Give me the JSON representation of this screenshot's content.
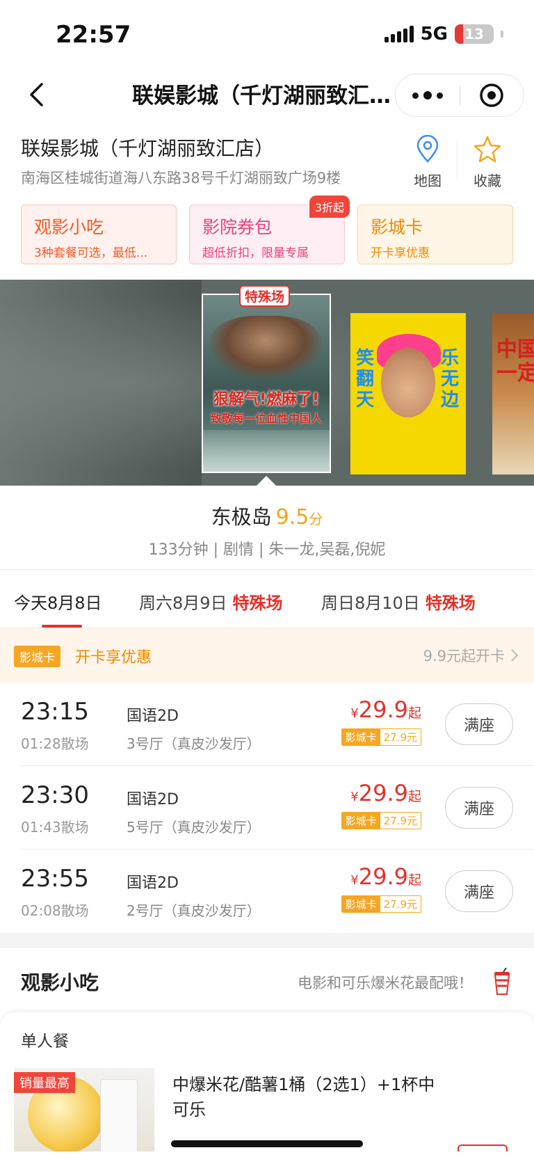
{
  "status_bar": {
    "time": "22:57",
    "network": "5G",
    "battery": "13"
  },
  "nav": {
    "title": "联娱影城（千灯湖丽致汇店）"
  },
  "cinema": {
    "name": "联娱影城（千灯湖丽致汇店）",
    "address": "南海区桂城街道海八东路38号千灯湖丽致广场9楼",
    "map_label": "地图",
    "favorite_label": "收藏"
  },
  "features": [
    {
      "title": "观影小吃",
      "subtitle": "3种套餐可选，最低...",
      "badge": ""
    },
    {
      "title": "影院券包",
      "subtitle": "超低折扣，限量专属",
      "badge": "3折起"
    },
    {
      "title": "影城卡",
      "subtitle": "开卡享优惠",
      "badge": ""
    }
  ],
  "carousel": {
    "special_tag": "特殊场",
    "posters": [
      {
        "line1": "狠解气!燃麻了!",
        "line2": "致敬每一位血性中国人"
      },
      {
        "left_text": "笑翻天",
        "right_text": "乐无边"
      },
      {
        "text": "中国一定"
      }
    ]
  },
  "movie": {
    "title": "东极岛",
    "score": "9.5",
    "score_unit": "分",
    "meta": "133分钟 | 剧情 | 朱一龙,吴磊,倪妮"
  },
  "date_tabs": [
    {
      "label": "今天8月8日",
      "special": ""
    },
    {
      "label": "周六8月9日",
      "special": "特殊场"
    },
    {
      "label": "周日8月10日",
      "special": "特殊场"
    }
  ],
  "promo": {
    "badge": "影城卡",
    "text": "开卡享优惠",
    "right": "9.9元起开卡"
  },
  "showtimes": [
    {
      "start": "23:15",
      "end": "01:28散场",
      "lang": "国语2D",
      "hall": "3号厅（真皮沙发厅）",
      "currency": "¥",
      "price": "29.9",
      "price_suffix": "起",
      "card_label": "影城卡",
      "card_price": "27.9元",
      "button": "满座"
    },
    {
      "start": "23:30",
      "end": "01:43散场",
      "lang": "国语2D",
      "hall": "5号厅（真皮沙发厅）",
      "currency": "¥",
      "price": "29.9",
      "price_suffix": "起",
      "card_label": "影城卡",
      "card_price": "27.9元",
      "button": "满座"
    },
    {
      "start": "23:55",
      "end": "02:08散场",
      "lang": "国语2D",
      "hall": "2号厅（真皮沙发厅）",
      "currency": "¥",
      "price": "29.9",
      "price_suffix": "起",
      "card_label": "影城卡",
      "card_price": "27.9元",
      "button": "满座"
    }
  ],
  "snacks": {
    "title": "观影小吃",
    "subtitle": "电影和可乐爆米花最配哦！",
    "category": "单人餐",
    "item": {
      "badge": "销量最高",
      "name": "中爆米花/酷薯1桶（2选1）+1杯中可乐"
    }
  }
}
